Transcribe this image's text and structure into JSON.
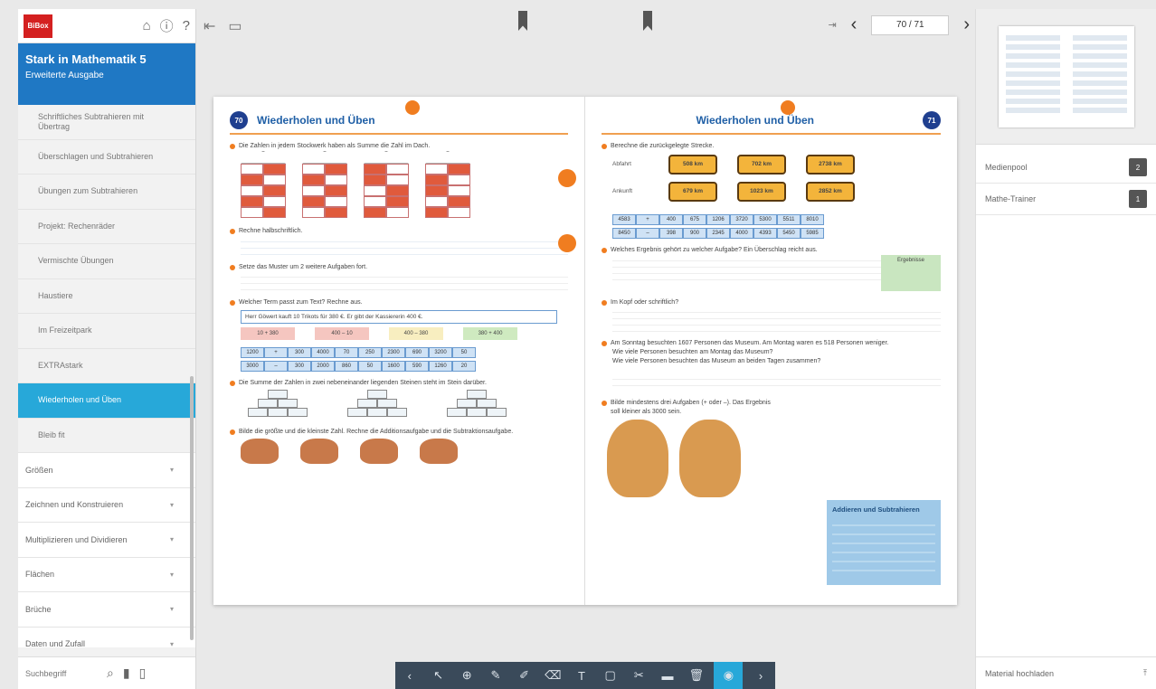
{
  "sidebar": {
    "logo": "BiBox",
    "book_title": "Stark in Mathematik 5",
    "book_subtitle": "Erweiterte Ausgabe",
    "items": [
      {
        "label": "Schriftliches Subtrahieren mit Übertrag",
        "active": false
      },
      {
        "label": "Überschlagen und Subtrahieren",
        "active": false
      },
      {
        "label": "Übungen zum Subtrahieren",
        "active": false
      },
      {
        "label": "Projekt: Rechenräder",
        "active": false
      },
      {
        "label": "Vermischte Übungen",
        "active": false
      },
      {
        "label": "Haustiere",
        "active": false
      },
      {
        "label": "Im Freizeitpark",
        "active": false
      },
      {
        "label": "EXTRAstark",
        "active": false
      },
      {
        "label": "Wiederholen und Üben",
        "active": true
      },
      {
        "label": "Bleib fit",
        "active": false
      }
    ],
    "categories": [
      "Größen",
      "Zeichnen und Konstruieren",
      "Multiplizieren und Dividieren",
      "Flächen",
      "Brüche",
      "Daten und Zufall"
    ],
    "search_placeholder": "Suchbegriff"
  },
  "toolbar": {
    "page_indicator": "70 / 71"
  },
  "spread": {
    "left": {
      "page_number": "70",
      "title": "Wiederholen und Üben",
      "task1": "Die Zahlen in jedem Stockwerk haben als Summe die Zahl im Dach.",
      "task2": "Rechne halbschriftlich.",
      "task3": "Setze das Muster um 2 weitere Aufgaben fort.",
      "task4": "Welcher Term passt zum Text? Rechne aus.",
      "task4_text": "Herr Göwert kauft 10 Trikots für 380 €. Er gibt der Kassiererin 400 €.",
      "task4_chips": [
        "10 + 380",
        "400 – 10",
        "400 – 380",
        "380 + 400"
      ],
      "table_a": [
        "1200",
        "+",
        "300",
        "4000",
        "70",
        "250",
        "2300",
        "690",
        "3200",
        "50"
      ],
      "table_b": [
        "3000",
        "–",
        "300",
        "2000",
        "860",
        "50",
        "1600",
        "590",
        "1260",
        "20"
      ],
      "task6": "Die Summe der Zahlen in zwei nebeneinander liegenden Steinen steht im Stein darüber.",
      "task7": "Bilde die größte und die kleinste Zahl. Rechne die Additionsaufgabe und die Subtraktionsaufgabe."
    },
    "right": {
      "page_number": "71",
      "title": "Wiederholen und Üben",
      "task1": "Berechne die zurückgelegte Strecke.",
      "abfahrt": "Abfahrt",
      "ankunft": "Ankunft",
      "signs_top": [
        "508 km",
        "702 km",
        "2738 km"
      ],
      "signs_bottom": [
        "679 km",
        "1023 km",
        "2852 km"
      ],
      "table_a": [
        "4583",
        "+",
        "400",
        "675",
        "1206",
        "3720",
        "5300",
        "5511",
        "8010"
      ],
      "table_b": [
        "8450",
        "–",
        "398",
        "900",
        "2345",
        "4000",
        "4393",
        "5450",
        "5985"
      ],
      "task3": "Welches Ergebnis gehört zu welcher Aufgabe? Ein Überschlag reicht aus.",
      "ergebnisse": "Ergebnisse",
      "task4": "Im Kopf oder schriftlich?",
      "task5": "Am Sonntag besuchten 1607 Personen das Museum. Am Montag waren es 518 Personen weniger.",
      "task5a": "Wie viele Personen besuchten am Montag das Museum?",
      "task5b": "Wie viele Personen besuchten das Museum an beiden Tagen zusammen?",
      "task7": "Bilde mindestens drei Aufgaben (+ oder –). Das Ergebnis soll kleiner als 3000 sein.",
      "info_title": "Addieren und Subtrahieren"
    }
  },
  "right_panel": {
    "items": [
      {
        "label": "Medienpool",
        "count": "2"
      },
      {
        "label": "Mathe-Trainer",
        "count": "1"
      }
    ],
    "upload_label": "Material hochladen"
  }
}
